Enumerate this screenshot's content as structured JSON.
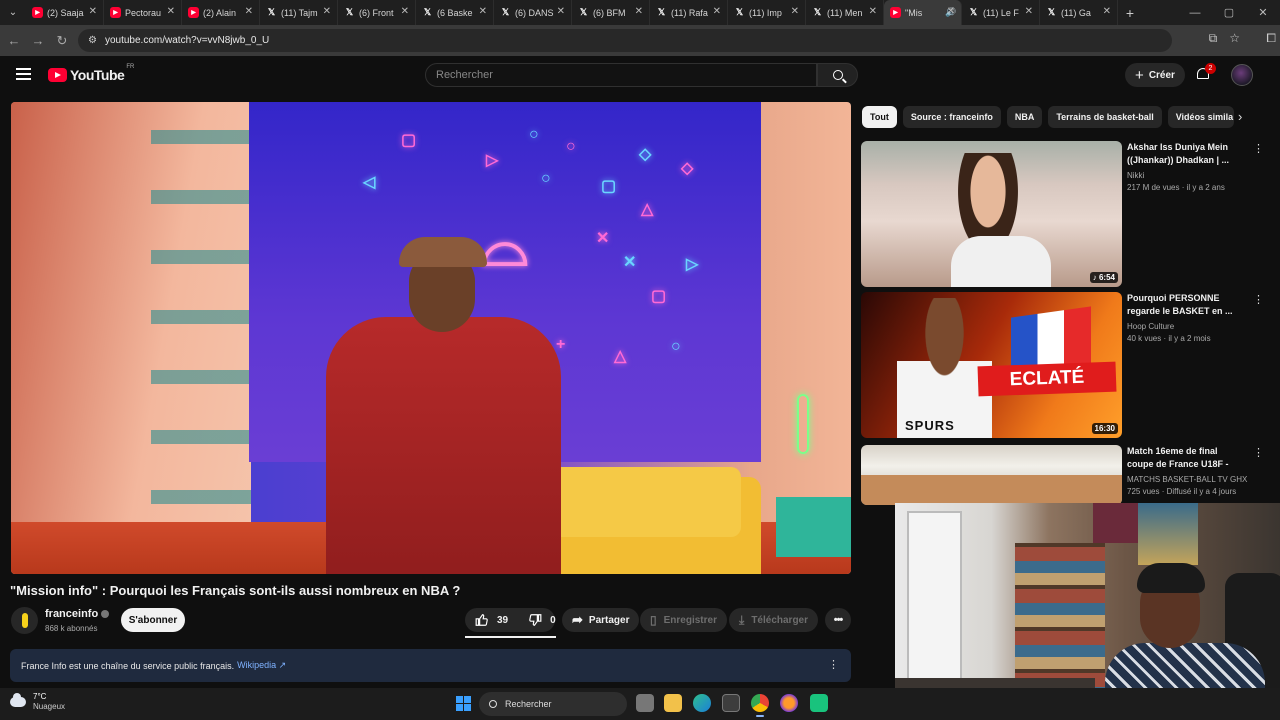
{
  "browser": {
    "tabs": [
      {
        "label": "(2) Saaja",
        "type": "youtube"
      },
      {
        "label": "Pectorau",
        "type": "youtube"
      },
      {
        "label": "(2) Alain",
        "type": "youtube"
      },
      {
        "label": "(11) Tajm",
        "type": "x"
      },
      {
        "label": "(6) Front",
        "type": "x"
      },
      {
        "label": "(6 Baske",
        "type": "x"
      },
      {
        "label": "(6) DANS",
        "type": "x"
      },
      {
        "label": "(6) BFM",
        "type": "x"
      },
      {
        "label": "(11) Rafa",
        "type": "x"
      },
      {
        "label": "(11) Imp",
        "type": "x"
      },
      {
        "label": "(11) Men",
        "type": "x"
      },
      {
        "label": "\"Mis",
        "type": "youtube",
        "active": true
      },
      {
        "label": "(11) Le F",
        "type": "x"
      },
      {
        "label": "(11) Ga",
        "type": "x"
      }
    ],
    "url": "youtube.com/watch?v=vvN8jwb_0_U"
  },
  "youtube": {
    "logo_text": "YouTube",
    "country_code": "FR",
    "search_placeholder": "Rechercher",
    "create_label": "Créer",
    "notification_count": "2"
  },
  "video": {
    "title": "\"Mission info\" : Pourquoi les Français sont-ils aussi nombreux en NBA ?",
    "channel": "franceinfo",
    "subscribers": "868 k abonnés",
    "subscribe_label": "S'abonner",
    "likes": "39",
    "dislikes": "0",
    "share_label": "Partager",
    "save_label": "Enregistrer",
    "download_label": "Télécharger",
    "info_text": "France Info est une chaîne du service public français.",
    "info_link": "Wikipedia"
  },
  "chips": [
    "Tout",
    "Source : franceinfo",
    "NBA",
    "Terrains de basket-ball",
    "Vidéos simila"
  ],
  "recommendations": [
    {
      "title": "Akshar Iss Duniya Mein ((Jhankar)) Dhadkan | ...",
      "channel": "Nikki",
      "meta": "217 M de vues · il y a 2 ans",
      "duration": "6:54"
    },
    {
      "title": "Pourquoi PERSONNE regarde le BASKET en ...",
      "channel": "Hoop Culture",
      "meta": "40 k vues · il y a 2 mois",
      "duration": "16:30",
      "overlay_text": "ECLATÉ",
      "jersey_text": "SPURS"
    },
    {
      "title": "Match 16eme de final coupe de France U18F - ...",
      "channel": "MATCHS BASKET-BALL TV GHX",
      "meta": "725 vues · Diffusé il y a 4 jours",
      "duration": ""
    }
  ],
  "taskbar": {
    "temperature": "7°C",
    "condition": "Nuageux",
    "search_label": "Rechercher"
  },
  "colors": {
    "youtube_red": "#ff0033",
    "info_panel": "#1f2a3e",
    "link_blue": "#7fb2ff"
  }
}
